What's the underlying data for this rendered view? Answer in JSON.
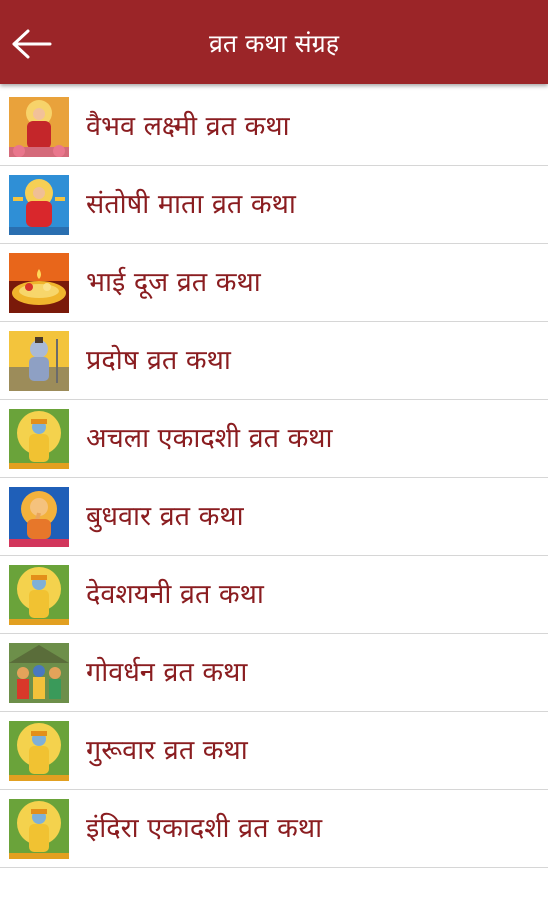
{
  "header": {
    "title": "व्रत कथा संग्रह",
    "back_icon": "arrow-left-icon"
  },
  "colors": {
    "appbar": "#9b2528",
    "item_text": "#8a1d20",
    "divider": "#d6d6d6"
  },
  "items": [
    {
      "label": "वैभव लक्ष्मी व्रत कथा",
      "thumb": "lakshmi"
    },
    {
      "label": "संतोषी माता व्रत कथा",
      "thumb": "santoshi"
    },
    {
      "label": "भाई दूज व्रत कथा",
      "thumb": "thali"
    },
    {
      "label": "प्रदोष व्रत कथा",
      "thumb": "shiva"
    },
    {
      "label": "अचला एकादशी व्रत कथा",
      "thumb": "vishnu"
    },
    {
      "label": "बुधवार व्रत कथा",
      "thumb": "ganesha"
    },
    {
      "label": "देवशयनी व्रत कथा",
      "thumb": "vishnu"
    },
    {
      "label": "गोवर्धन व्रत कथा",
      "thumb": "krishna"
    },
    {
      "label": "गुरूवार व्रत कथा",
      "thumb": "vishnu"
    },
    {
      "label": "इंदिरा एकादशी व्रत कथा",
      "thumb": "vishnu"
    }
  ]
}
